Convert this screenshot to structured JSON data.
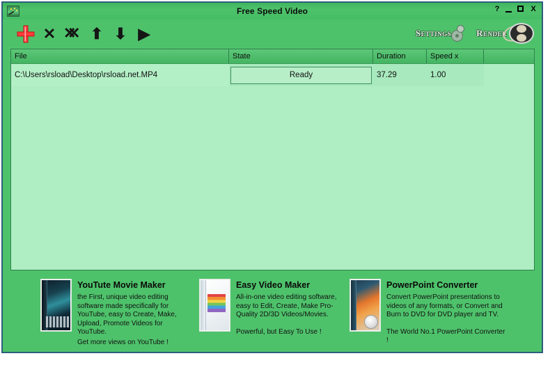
{
  "window": {
    "title": "Free Speed Video",
    "icon": "wand-sparkle-icon",
    "controls": {
      "help": "?",
      "minimize": "–",
      "maximize": "□",
      "close": "X"
    },
    "colors": {
      "title_bar": "#4ec26b",
      "body": "#4ec26b",
      "border": "#2c5d7a",
      "list_bg": "#aeeec2",
      "row_selected": "#b4f0c6",
      "accent_add": "#ff2a2a"
    }
  },
  "toolbar": {
    "buttons": [
      {
        "name": "add-file-button",
        "icon": "plus-icon",
        "glyph": "+"
      },
      {
        "name": "remove-file-button",
        "icon": "x-icon",
        "glyph": "✕"
      },
      {
        "name": "remove-all-files-button",
        "icon": "double-x-icon",
        "glyph": "✕"
      },
      {
        "name": "move-up-button",
        "icon": "arrow-up-icon",
        "glyph": "↑"
      },
      {
        "name": "move-down-button",
        "icon": "arrow-down-icon",
        "glyph": "↓"
      },
      {
        "name": "play-preview-button",
        "icon": "play-icon",
        "glyph": "▶"
      }
    ],
    "settings_label": "Settings",
    "render_label": "Render"
  },
  "file_list": {
    "columns": [
      {
        "key": "file",
        "label": "File"
      },
      {
        "key": "state",
        "label": "State"
      },
      {
        "key": "duration",
        "label": "Duration"
      },
      {
        "key": "speed",
        "label": "Speed x"
      },
      {
        "key": "extra",
        "label": ""
      }
    ],
    "rows": [
      {
        "file": "C:\\Users\\rsload\\Desktop\\rsload.net.MP4",
        "state": "Ready",
        "duration": "37.29",
        "speed": "1.00",
        "extra": ""
      }
    ]
  },
  "ads": [
    {
      "name": "ad-youtute-movie-maker",
      "box": "b0",
      "title": "YouTute Movie Maker",
      "desc": "the First, unique video editing software made specifically for YouTube, easy to Create, Make, Upload, Promote Videos for YouTube.",
      "tagline": "Get more views on YouTube !",
      "tag_gap": false
    },
    {
      "name": "ad-easy-video-maker",
      "box": "b1",
      "title": "Easy Video Maker",
      "desc": "All-in-one video editing software, easy to Edit, Create, Make Pro-Quality 2D/3D Videos/Movies.",
      "tagline": "Powerful, but Easy To Use !",
      "tag_gap": true
    },
    {
      "name": "ad-powerpoint-converter",
      "box": "b2",
      "title": "PowerPoint Converter",
      "desc": "Convert PowerPoint presentations to videos of any formats, or Convert and Burn to DVD for DVD player and TV.",
      "tagline": "The World No.1 PowerPoint Converter !",
      "tag_gap": true
    }
  ]
}
